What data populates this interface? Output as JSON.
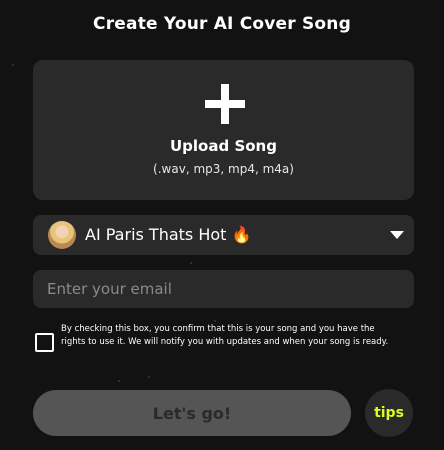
{
  "header": {
    "title": "Create Your AI Cover Song"
  },
  "upload": {
    "icon": "plus-icon",
    "label": "Upload Song",
    "formats": "(.wav, mp3, mp4, m4a)"
  },
  "voice": {
    "selected": "AI Paris Thats Hot 🔥",
    "avatar": "paris-avatar",
    "dropdown_icon": "caret-down-icon"
  },
  "email": {
    "value": "",
    "placeholder": "Enter your email"
  },
  "consent": {
    "checked": false,
    "text": "By checking this box, you confirm that this is your song and you have the rights to use it. We will notify you with updates and when your song is ready."
  },
  "actions": {
    "submit_label": "Let's go!",
    "tips_label": "tips"
  },
  "colors": {
    "background": "#121212",
    "panel": "#2a2a2a",
    "submit_disabled": "#555555",
    "tips_accent": "#d7ff1f"
  }
}
